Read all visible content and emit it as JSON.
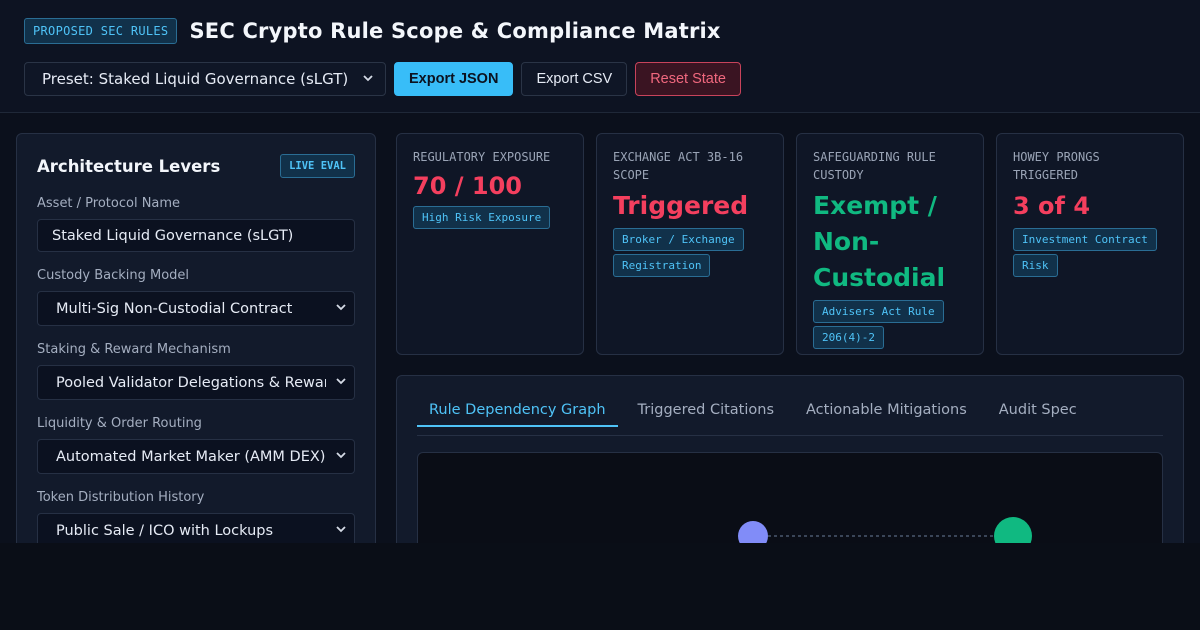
{
  "header": {
    "badge": "PROPOSED SEC RULES",
    "title": "SEC Crypto Rule Scope & Compliance Matrix",
    "preset_value": "Preset: Staked Liquid Governance (sLGT)",
    "export_json": "Export JSON",
    "export_csv": "Export CSV",
    "reset": "Reset State"
  },
  "levers": {
    "title": "Architecture Levers",
    "badge": "LIVE EVAL",
    "asset_label": "Asset / Protocol Name",
    "asset_value": "Staked Liquid Governance (sLGT)",
    "custody_label": "Custody Backing Model",
    "custody_value": "Multi-Sig Non-Custodial Contract",
    "staking_label": "Staking & Reward Mechanism",
    "staking_value": "Pooled Validator Delegations & Rewards",
    "liquidity_label": "Liquidity & Order Routing",
    "liquidity_value": "Automated Market Maker (AMM DEX)",
    "distribution_label": "Token Distribution History",
    "distribution_value": "Public Sale / ICO with Lockups"
  },
  "metrics": [
    {
      "label": "REGULATORY EXPOSURE",
      "value": "70 / 100",
      "tag": "High Risk Exposure"
    },
    {
      "label": "EXCHANGE ACT 3B-16 SCOPE",
      "value": "Triggered",
      "tag": "Broker / Exchange Registration"
    },
    {
      "label": "SAFEGUARDING RULE CUSTODY",
      "value": "Exempt / Non-Custodial",
      "tag": "Advisers Act Rule 206(4)-2"
    },
    {
      "label": "HOWEY PRONGS TRIGGERED",
      "value": "3 of 4",
      "tag": "Investment Contract Risk"
    }
  ],
  "tabs": [
    "Rule Dependency Graph",
    "Triggered Citations",
    "Actionable Mitigations",
    "Audit Spec"
  ],
  "colors": {
    "accent": "#38bdf8",
    "danger": "#f43f5e",
    "success": "#10b981",
    "node_purple": "#818cf8"
  }
}
